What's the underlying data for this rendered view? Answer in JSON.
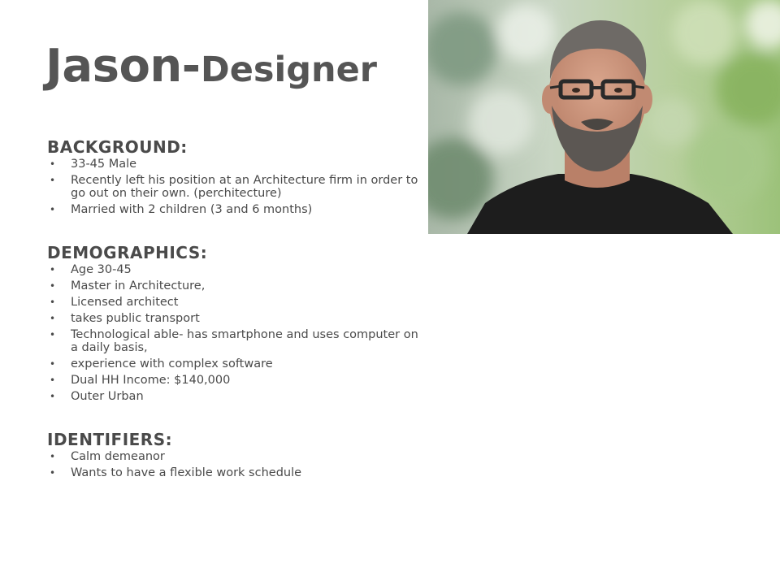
{
  "persona": {
    "name": "Jason",
    "separator": "-",
    "role": "Designer"
  },
  "sections": {
    "background": {
      "heading": "BACKGROUND:",
      "items": [
        "33-45 Male",
        "Recently left his position at an Architecture firm in order to go out on their own. (perchitecture)",
        "Married with 2 children (3 and 6 months)"
      ]
    },
    "demographics": {
      "heading": "DEMOGRAPHICS:",
      "items": [
        "Age 30-45",
        "Master in Architecture,",
        "Licensed architect",
        "takes public transport",
        "Technological able- has smartphone and uses computer on a daily basis,",
        "experience with complex software",
        "Dual HH Income: $140,000",
        "Outer Urban"
      ]
    },
    "identifiers": {
      "heading": "IDENTIFIERS:",
      "items": [
        "Calm demeanor",
        "Wants to have a flexible work schedule"
      ]
    }
  },
  "bullet_glyph": "•",
  "colors": {
    "title": "#555555",
    "text": "#4a4a4a",
    "background": "#ffffff"
  }
}
